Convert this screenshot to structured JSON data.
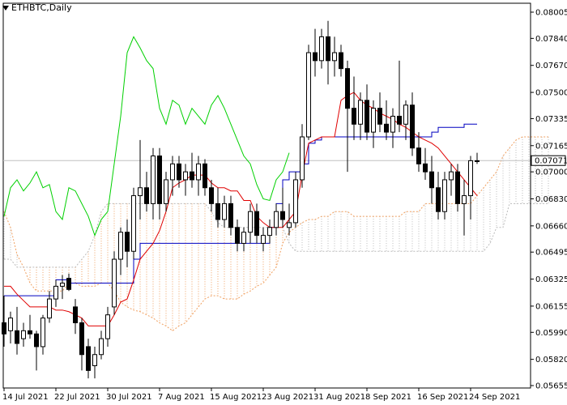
{
  "header": {
    "symbol_label": "ETHBTC,Daily"
  },
  "colors": {
    "background": "#ffffff",
    "candle": "#000000",
    "tenkan": "#e00000",
    "kijun": "#0000c0",
    "chikou": "#00d000",
    "cloud_bull": "#bbbbbb",
    "cloud_bear": "#f0a060",
    "current_line": "#c0c0c0"
  },
  "chart_data": {
    "type": "candlestick",
    "title": "ETHBTC,Daily",
    "current_price": "0.07071",
    "ylim": [
      0.05655,
      0.08005
    ],
    "y_ticks": [
      "0.08005",
      "0.07840",
      "0.07670",
      "0.07500",
      "0.07335",
      "0.07165",
      "0.07000",
      "0.06830",
      "0.06660",
      "0.06495",
      "0.06325",
      "0.06155",
      "0.05990",
      "0.05820",
      "0.05655"
    ],
    "x_ticks": [
      "14 Jul 2021",
      "22 Jul 2021",
      "30 Jul 2021",
      "7 Aug 2021",
      "15 Aug 2021",
      "23 Aug 2021",
      "31 Aug 2021",
      "8 Sep 2021",
      "16 Sep 2021",
      "24 Sep 2021"
    ],
    "candles": [
      [
        0.0605,
        0.0622,
        0.059,
        0.0598
      ],
      [
        0.06,
        0.0612,
        0.0592,
        0.0608
      ],
      [
        0.06,
        0.0615,
        0.0585,
        0.0592
      ],
      [
        0.0595,
        0.0605,
        0.059,
        0.06
      ],
      [
        0.06,
        0.061,
        0.0595,
        0.0598
      ],
      [
        0.0598,
        0.06,
        0.0575,
        0.059
      ],
      [
        0.059,
        0.061,
        0.0585,
        0.0608
      ],
      [
        0.0608,
        0.0625,
        0.0605,
        0.062
      ],
      [
        0.062,
        0.0632,
        0.0615,
        0.0628
      ],
      [
        0.0628,
        0.0635,
        0.062,
        0.063
      ],
      [
        0.0633,
        0.0636,
        0.0625,
        0.0626
      ],
      [
        0.0615,
        0.062,
        0.0598,
        0.0605
      ],
      [
        0.0605,
        0.0608,
        0.0575,
        0.0585
      ],
      [
        0.059,
        0.0595,
        0.057,
        0.0575
      ],
      [
        0.0578,
        0.059,
        0.057,
        0.0585
      ],
      [
        0.0585,
        0.06,
        0.0582,
        0.0595
      ],
      [
        0.0595,
        0.0615,
        0.059,
        0.061
      ],
      [
        0.0615,
        0.065,
        0.061,
        0.0645
      ],
      [
        0.0645,
        0.0665,
        0.0635,
        0.0662
      ],
      [
        0.0662,
        0.067,
        0.064,
        0.065
      ],
      [
        0.065,
        0.069,
        0.0645,
        0.0685
      ],
      [
        0.0685,
        0.072,
        0.067,
        0.069
      ],
      [
        0.069,
        0.07,
        0.0675,
        0.068
      ],
      [
        0.068,
        0.0715,
        0.067,
        0.071
      ],
      [
        0.071,
        0.0715,
        0.067,
        0.068
      ],
      [
        0.068,
        0.07,
        0.0675,
        0.0695
      ],
      [
        0.0695,
        0.071,
        0.0685,
        0.0705
      ],
      [
        0.0705,
        0.071,
        0.069,
        0.0695
      ],
      [
        0.0695,
        0.0705,
        0.0685,
        0.07
      ],
      [
        0.07,
        0.0712,
        0.069,
        0.0695
      ],
      [
        0.0695,
        0.071,
        0.0685,
        0.0705
      ],
      [
        0.0705,
        0.0708,
        0.0685,
        0.069
      ],
      [
        0.069,
        0.0695,
        0.0675,
        0.068
      ],
      [
        0.068,
        0.069,
        0.0665,
        0.067
      ],
      [
        0.067,
        0.0685,
        0.0665,
        0.068
      ],
      [
        0.068,
        0.0685,
        0.066,
        0.0665
      ],
      [
        0.0665,
        0.067,
        0.065,
        0.0655
      ],
      [
        0.0655,
        0.0665,
        0.065,
        0.0662
      ],
      [
        0.0662,
        0.068,
        0.0655,
        0.0675
      ],
      [
        0.0675,
        0.068,
        0.0655,
        0.066
      ],
      [
        0.0655,
        0.0665,
        0.065,
        0.066
      ],
      [
        0.066,
        0.067,
        0.0655,
        0.0665
      ],
      [
        0.0665,
        0.068,
        0.066,
        0.0675
      ],
      [
        0.0675,
        0.069,
        0.0665,
        0.067
      ],
      [
        0.0665,
        0.068,
        0.066,
        0.0668
      ],
      [
        0.0668,
        0.07,
        0.0665,
        0.0695
      ],
      [
        0.0695,
        0.073,
        0.069,
        0.0722
      ],
      [
        0.0722,
        0.078,
        0.072,
        0.0775
      ],
      [
        0.0775,
        0.079,
        0.076,
        0.077
      ],
      [
        0.077,
        0.079,
        0.0765,
        0.0785
      ],
      [
        0.0785,
        0.0795,
        0.0755,
        0.077
      ],
      [
        0.077,
        0.0785,
        0.076,
        0.0775
      ],
      [
        0.0775,
        0.078,
        0.076,
        0.0765
      ],
      [
        0.0765,
        0.077,
        0.07,
        0.074
      ],
      [
        0.074,
        0.076,
        0.072,
        0.073
      ],
      [
        0.073,
        0.075,
        0.072,
        0.0745
      ],
      [
        0.0745,
        0.0755,
        0.072,
        0.0725
      ],
      [
        0.0725,
        0.0745,
        0.0715,
        0.074
      ],
      [
        0.074,
        0.075,
        0.0725,
        0.073
      ],
      [
        0.073,
        0.0745,
        0.072,
        0.0725
      ],
      [
        0.0725,
        0.074,
        0.0715,
        0.0735
      ],
      [
        0.0735,
        0.077,
        0.0725,
        0.073
      ],
      [
        0.073,
        0.0745,
        0.072,
        0.0742
      ],
      [
        0.0742,
        0.075,
        0.071,
        0.0715
      ],
      [
        0.0715,
        0.0725,
        0.07,
        0.0705
      ],
      [
        0.0705,
        0.0715,
        0.0695,
        0.07
      ],
      [
        0.07,
        0.071,
        0.068,
        0.069
      ],
      [
        0.069,
        0.07,
        0.067,
        0.0675
      ],
      [
        0.0675,
        0.07,
        0.067,
        0.0695
      ],
      [
        0.0695,
        0.0705,
        0.0685,
        0.07
      ],
      [
        0.07,
        0.0705,
        0.0675,
        0.068
      ],
      [
        0.068,
        0.0695,
        0.066,
        0.0685
      ],
      [
        0.0685,
        0.071,
        0.067,
        0.0707
      ],
      [
        0.0707,
        0.0712,
        0.0705,
        0.0707
      ]
    ],
    "tenkan": [
      0.0628,
      0.0628,
      0.0623,
      0.0619,
      0.0615,
      0.0615,
      0.0615,
      0.0615,
      0.0613,
      0.0613,
      0.0612,
      0.061,
      0.0608,
      0.0603,
      0.0603,
      0.0603,
      0.0603,
      0.061,
      0.0618,
      0.062,
      0.0632,
      0.0645,
      0.065,
      0.0655,
      0.0663,
      0.0675,
      0.069,
      0.0693,
      0.0695,
      0.0698,
      0.0698,
      0.0698,
      0.0693,
      0.069,
      0.069,
      0.0688,
      0.0688,
      0.0682,
      0.0682,
      0.0672,
      0.0668,
      0.0665,
      0.0665,
      0.0665,
      0.067,
      0.0675,
      0.0698,
      0.0718,
      0.072,
      0.0722,
      0.0722,
      0.0722,
      0.0745,
      0.0748,
      0.075,
      0.0745,
      0.0742,
      0.074,
      0.0737,
      0.0735,
      0.0733,
      0.073,
      0.0728,
      0.0725,
      0.0722,
      0.072,
      0.0718,
      0.0715,
      0.071,
      0.0705,
      0.07,
      0.0695,
      0.069,
      0.0685
    ],
    "kijun": [
      0.0622,
      0.0622,
      0.0622,
      0.0622,
      0.0622,
      0.0622,
      0.0622,
      0.0622,
      0.0632,
      0.0632,
      0.063,
      0.063,
      0.063,
      0.063,
      0.063,
      0.063,
      0.063,
      0.063,
      0.063,
      0.063,
      0.0645,
      0.0655,
      0.0655,
      0.0655,
      0.0655,
      0.0655,
      0.0655,
      0.0655,
      0.0655,
      0.0655,
      0.0655,
      0.0655,
      0.0655,
      0.0655,
      0.0655,
      0.0655,
      0.0655,
      0.0655,
      0.0655,
      0.0655,
      0.0655,
      0.0665,
      0.068,
      0.0695,
      0.07,
      0.07,
      0.0705,
      0.0718,
      0.072,
      0.0722,
      0.0722,
      0.0722,
      0.0722,
      0.0722,
      0.0722,
      0.0722,
      0.0722,
      0.0722,
      0.0722,
      0.0722,
      0.0722,
      0.0722,
      0.0722,
      0.0722,
      0.0722,
      0.0722,
      0.0725,
      0.0728,
      0.0728,
      0.0728,
      0.0728,
      0.073,
      0.073,
      0.073
    ],
    "chikou": [
      0.0672,
      0.069,
      0.0695,
      0.0688,
      0.0693,
      0.07,
      0.069,
      0.0692,
      0.0675,
      0.067,
      0.069,
      0.0688,
      0.068,
      0.0672,
      0.066,
      0.067,
      0.0675,
      0.0705,
      0.0735,
      0.0775,
      0.0785,
      0.0778,
      0.077,
      0.0765,
      0.074,
      0.073,
      0.0745,
      0.0742,
      0.073,
      0.074,
      0.0735,
      0.073,
      0.0742,
      0.0748,
      0.074,
      0.073,
      0.072,
      0.071,
      0.0705,
      0.0692,
      0.0683,
      0.0682,
      0.0695,
      0.07,
      0.0712
    ],
    "senkou_a": [
      0.0675,
      0.0665,
      0.0648,
      0.064,
      0.063,
      0.0625,
      0.0625,
      0.0625,
      0.0625,
      0.0625,
      0.063,
      0.063,
      0.0628,
      0.0628,
      0.0628,
      0.063,
      0.063,
      0.0625,
      0.0618,
      0.0615,
      0.0613,
      0.0612,
      0.061,
      0.0608,
      0.0605,
      0.0603,
      0.06,
      0.0603,
      0.0605,
      0.061,
      0.0615,
      0.062,
      0.0622,
      0.0622,
      0.062,
      0.062,
      0.062,
      0.0623,
      0.0625,
      0.0628,
      0.063,
      0.0635,
      0.064,
      0.0655,
      0.0662,
      0.0665,
      0.0668,
      0.067,
      0.067,
      0.0672,
      0.0672,
      0.0675,
      0.0675,
      0.0675,
      0.0672,
      0.0672,
      0.0672,
      0.0672,
      0.0672,
      0.0672,
      0.0672,
      0.0672,
      0.0675,
      0.0675,
      0.0675,
      0.068,
      0.068,
      0.068,
      0.068,
      0.068,
      0.068,
      0.068,
      0.068,
      0.0685,
      0.069,
      0.0695,
      0.07,
      0.071,
      0.0715,
      0.072,
      0.0722,
      0.0722,
      0.0722,
      0.0722,
      0.0722
    ],
    "senkou_b": [
      0.0645,
      0.0645,
      0.064,
      0.064,
      0.064,
      0.064,
      0.064,
      0.064,
      0.064,
      0.064,
      0.064,
      0.064,
      0.0645,
      0.065,
      0.066,
      0.0675,
      0.068,
      0.068,
      0.068,
      0.068,
      0.068,
      0.068,
      0.068,
      0.068,
      0.068,
      0.068,
      0.068,
      0.068,
      0.068,
      0.068,
      0.068,
      0.068,
      0.0675,
      0.0668,
      0.0665,
      0.0665,
      0.0665,
      0.0665,
      0.0665,
      0.0665,
      0.0665,
      0.0665,
      0.0665,
      0.0665,
      0.0655,
      0.065,
      0.065,
      0.065,
      0.065,
      0.065,
      0.065,
      0.065,
      0.065,
      0.065,
      0.065,
      0.065,
      0.065,
      0.065,
      0.065,
      0.065,
      0.065,
      0.065,
      0.065,
      0.065,
      0.065,
      0.065,
      0.065,
      0.065,
      0.065,
      0.065,
      0.065,
      0.065,
      0.065,
      0.065,
      0.065,
      0.0655,
      0.0665,
      0.0665,
      0.068,
      0.068,
      0.068,
      0.068,
      0.068,
      0.068,
      0.068
    ]
  }
}
